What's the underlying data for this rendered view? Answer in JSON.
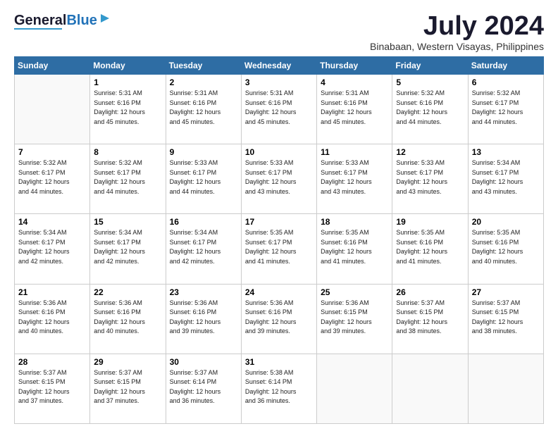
{
  "header": {
    "logo_general": "General",
    "logo_blue": "Blue",
    "month_year": "July 2024",
    "location": "Binabaan, Western Visayas, Philippines"
  },
  "days_of_week": [
    "Sunday",
    "Monday",
    "Tuesday",
    "Wednesday",
    "Thursday",
    "Friday",
    "Saturday"
  ],
  "weeks": [
    [
      {
        "day": "",
        "info": ""
      },
      {
        "day": "1",
        "info": "Sunrise: 5:31 AM\nSunset: 6:16 PM\nDaylight: 12 hours\nand 45 minutes."
      },
      {
        "day": "2",
        "info": "Sunrise: 5:31 AM\nSunset: 6:16 PM\nDaylight: 12 hours\nand 45 minutes."
      },
      {
        "day": "3",
        "info": "Sunrise: 5:31 AM\nSunset: 6:16 PM\nDaylight: 12 hours\nand 45 minutes."
      },
      {
        "day": "4",
        "info": "Sunrise: 5:31 AM\nSunset: 6:16 PM\nDaylight: 12 hours\nand 45 minutes."
      },
      {
        "day": "5",
        "info": "Sunrise: 5:32 AM\nSunset: 6:16 PM\nDaylight: 12 hours\nand 44 minutes."
      },
      {
        "day": "6",
        "info": "Sunrise: 5:32 AM\nSunset: 6:17 PM\nDaylight: 12 hours\nand 44 minutes."
      }
    ],
    [
      {
        "day": "7",
        "info": "Sunrise: 5:32 AM\nSunset: 6:17 PM\nDaylight: 12 hours\nand 44 minutes."
      },
      {
        "day": "8",
        "info": "Sunrise: 5:32 AM\nSunset: 6:17 PM\nDaylight: 12 hours\nand 44 minutes."
      },
      {
        "day": "9",
        "info": "Sunrise: 5:33 AM\nSunset: 6:17 PM\nDaylight: 12 hours\nand 44 minutes."
      },
      {
        "day": "10",
        "info": "Sunrise: 5:33 AM\nSunset: 6:17 PM\nDaylight: 12 hours\nand 43 minutes."
      },
      {
        "day": "11",
        "info": "Sunrise: 5:33 AM\nSunset: 6:17 PM\nDaylight: 12 hours\nand 43 minutes."
      },
      {
        "day": "12",
        "info": "Sunrise: 5:33 AM\nSunset: 6:17 PM\nDaylight: 12 hours\nand 43 minutes."
      },
      {
        "day": "13",
        "info": "Sunrise: 5:34 AM\nSunset: 6:17 PM\nDaylight: 12 hours\nand 43 minutes."
      }
    ],
    [
      {
        "day": "14",
        "info": "Sunrise: 5:34 AM\nSunset: 6:17 PM\nDaylight: 12 hours\nand 42 minutes."
      },
      {
        "day": "15",
        "info": "Sunrise: 5:34 AM\nSunset: 6:17 PM\nDaylight: 12 hours\nand 42 minutes."
      },
      {
        "day": "16",
        "info": "Sunrise: 5:34 AM\nSunset: 6:17 PM\nDaylight: 12 hours\nand 42 minutes."
      },
      {
        "day": "17",
        "info": "Sunrise: 5:35 AM\nSunset: 6:17 PM\nDaylight: 12 hours\nand 41 minutes."
      },
      {
        "day": "18",
        "info": "Sunrise: 5:35 AM\nSunset: 6:16 PM\nDaylight: 12 hours\nand 41 minutes."
      },
      {
        "day": "19",
        "info": "Sunrise: 5:35 AM\nSunset: 6:16 PM\nDaylight: 12 hours\nand 41 minutes."
      },
      {
        "day": "20",
        "info": "Sunrise: 5:35 AM\nSunset: 6:16 PM\nDaylight: 12 hours\nand 40 minutes."
      }
    ],
    [
      {
        "day": "21",
        "info": "Sunrise: 5:36 AM\nSunset: 6:16 PM\nDaylight: 12 hours\nand 40 minutes."
      },
      {
        "day": "22",
        "info": "Sunrise: 5:36 AM\nSunset: 6:16 PM\nDaylight: 12 hours\nand 40 minutes."
      },
      {
        "day": "23",
        "info": "Sunrise: 5:36 AM\nSunset: 6:16 PM\nDaylight: 12 hours\nand 39 minutes."
      },
      {
        "day": "24",
        "info": "Sunrise: 5:36 AM\nSunset: 6:16 PM\nDaylight: 12 hours\nand 39 minutes."
      },
      {
        "day": "25",
        "info": "Sunrise: 5:36 AM\nSunset: 6:15 PM\nDaylight: 12 hours\nand 39 minutes."
      },
      {
        "day": "26",
        "info": "Sunrise: 5:37 AM\nSunset: 6:15 PM\nDaylight: 12 hours\nand 38 minutes."
      },
      {
        "day": "27",
        "info": "Sunrise: 5:37 AM\nSunset: 6:15 PM\nDaylight: 12 hours\nand 38 minutes."
      }
    ],
    [
      {
        "day": "28",
        "info": "Sunrise: 5:37 AM\nSunset: 6:15 PM\nDaylight: 12 hours\nand 37 minutes."
      },
      {
        "day": "29",
        "info": "Sunrise: 5:37 AM\nSunset: 6:15 PM\nDaylight: 12 hours\nand 37 minutes."
      },
      {
        "day": "30",
        "info": "Sunrise: 5:37 AM\nSunset: 6:14 PM\nDaylight: 12 hours\nand 36 minutes."
      },
      {
        "day": "31",
        "info": "Sunrise: 5:38 AM\nSunset: 6:14 PM\nDaylight: 12 hours\nand 36 minutes."
      },
      {
        "day": "",
        "info": ""
      },
      {
        "day": "",
        "info": ""
      },
      {
        "day": "",
        "info": ""
      }
    ]
  ]
}
